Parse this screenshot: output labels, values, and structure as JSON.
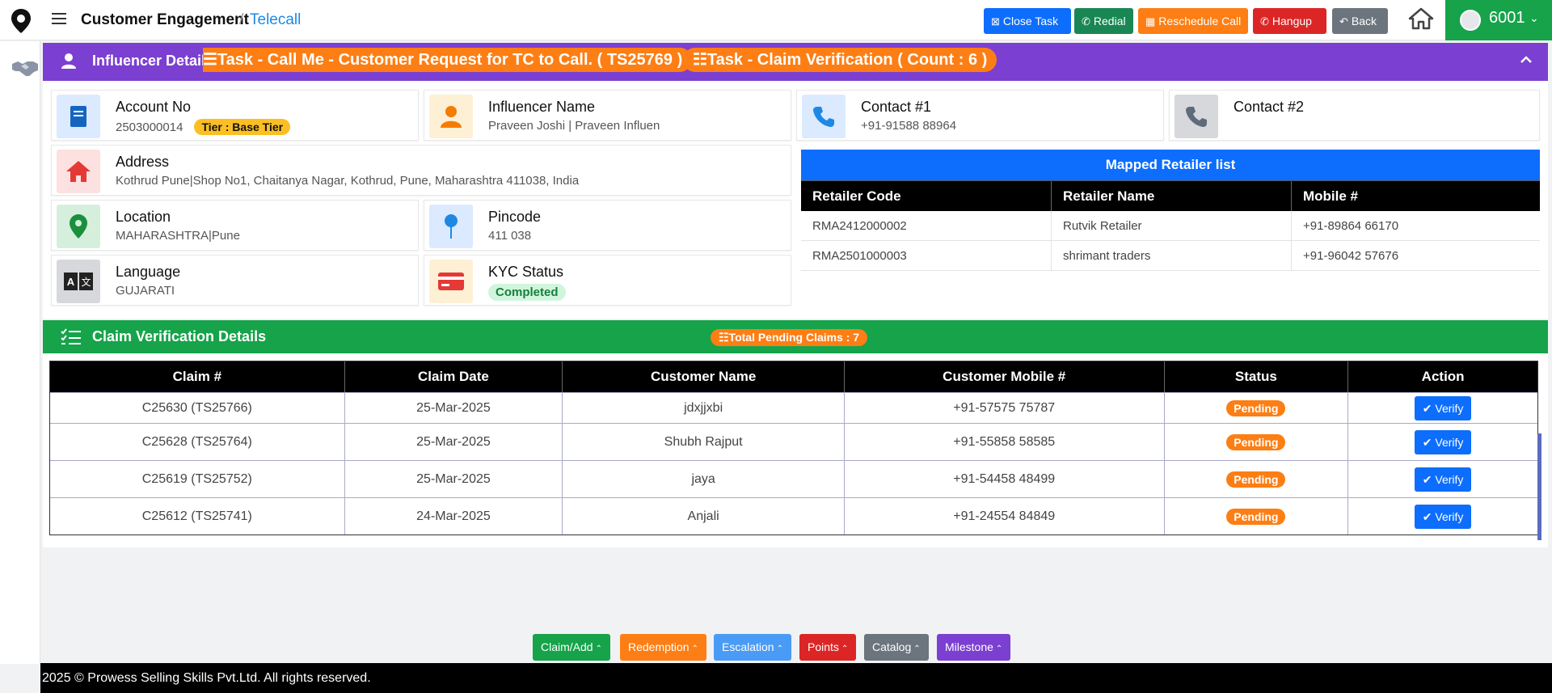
{
  "header": {
    "app_title": "Customer Engagement",
    "separator": "/",
    "breadcrumb_sub": "Telecall",
    "buttons": {
      "close_task": "Close Task",
      "redial": "Redial",
      "reschedule": "Reschedule Call",
      "hangup": "Hangup",
      "back": "Back"
    },
    "user_id": "6001"
  },
  "influencer": {
    "section_title": "Influencer Details",
    "task_pill_1": "☰Task - Call Me - Customer Request for TC to Call. ( TS25769 )",
    "task_pill_2": "☷Task - Claim Verification ( Count : 6 )",
    "account_no_label": "Account No",
    "account_no": "2503000014",
    "tier": "Tier : Base Tier",
    "name_label": "Influencer Name",
    "name": "Praveen Joshi | Praveen Influen",
    "contact1_label": "Contact #1",
    "contact1": "+91-91588 88964",
    "contact2_label": "Contact #2",
    "address_label": "Address",
    "address": "Kothrud Pune|Shop No1, Chaitanya Nagar, Kothrud, Pune, Maharashtra 411038, India",
    "location_label": "Location",
    "location": "MAHARASHTRA|Pune",
    "pincode_label": "Pincode",
    "pincode": "411 038",
    "language_label": "Language",
    "language": "GUJARATI",
    "kyc_label": "KYC Status",
    "kyc": "Completed"
  },
  "mapped_retailers": {
    "title": "Mapped Retailer list",
    "columns": [
      "Retailer Code",
      "Retailer Name",
      "Mobile #"
    ],
    "rows": [
      [
        "RMA2412000002",
        "Rutvik Retailer",
        "+91-89864 66170"
      ],
      [
        "RMA2501000003",
        "shrimant traders",
        "+91-96042 57676"
      ]
    ]
  },
  "claims": {
    "section_title": "Claim Verification Details",
    "pending_pill": "☷Total Pending Claims : 7",
    "columns": [
      "Claim #",
      "Claim Date",
      "Customer Name",
      "Customer Mobile #",
      "Status",
      "Action"
    ],
    "rows": [
      {
        "claim": "C25630 (TS25766)",
        "date": "25-Mar-2025",
        "name": "jdxjjxbi",
        "mobile": "+91-57575 75787",
        "status": "Pending",
        "action": "Verify"
      },
      {
        "claim": "C25628 (TS25764)",
        "date": "25-Mar-2025",
        "name": "Shubh Rajput",
        "mobile": "+91-55858 58585",
        "status": "Pending",
        "action": "Verify"
      },
      {
        "claim": "C25619 (TS25752)",
        "date": "25-Mar-2025",
        "name": "jaya",
        "mobile": "+91-54458 48499",
        "status": "Pending",
        "action": "Verify"
      },
      {
        "claim": "C25612 (TS25741)",
        "date": "24-Mar-2025",
        "name": "Anjali",
        "mobile": "+91-24554 84849",
        "status": "Pending",
        "action": "Verify"
      }
    ]
  },
  "bottom_tabs": {
    "claim": "Claim/Add",
    "redemption": "Redemption",
    "escalation": "Escalation",
    "points": "Points",
    "catalog": "Catalog",
    "milestone": "Milestone"
  },
  "footer": "2025 © Prowess Selling Skills Pvt.Ltd. All rights reserved.",
  "colors": {
    "purple_header": "#7b3fd1",
    "green_header": "#16a34a",
    "primary_blue": "#0d6efd",
    "orange": "#fd7e14"
  }
}
